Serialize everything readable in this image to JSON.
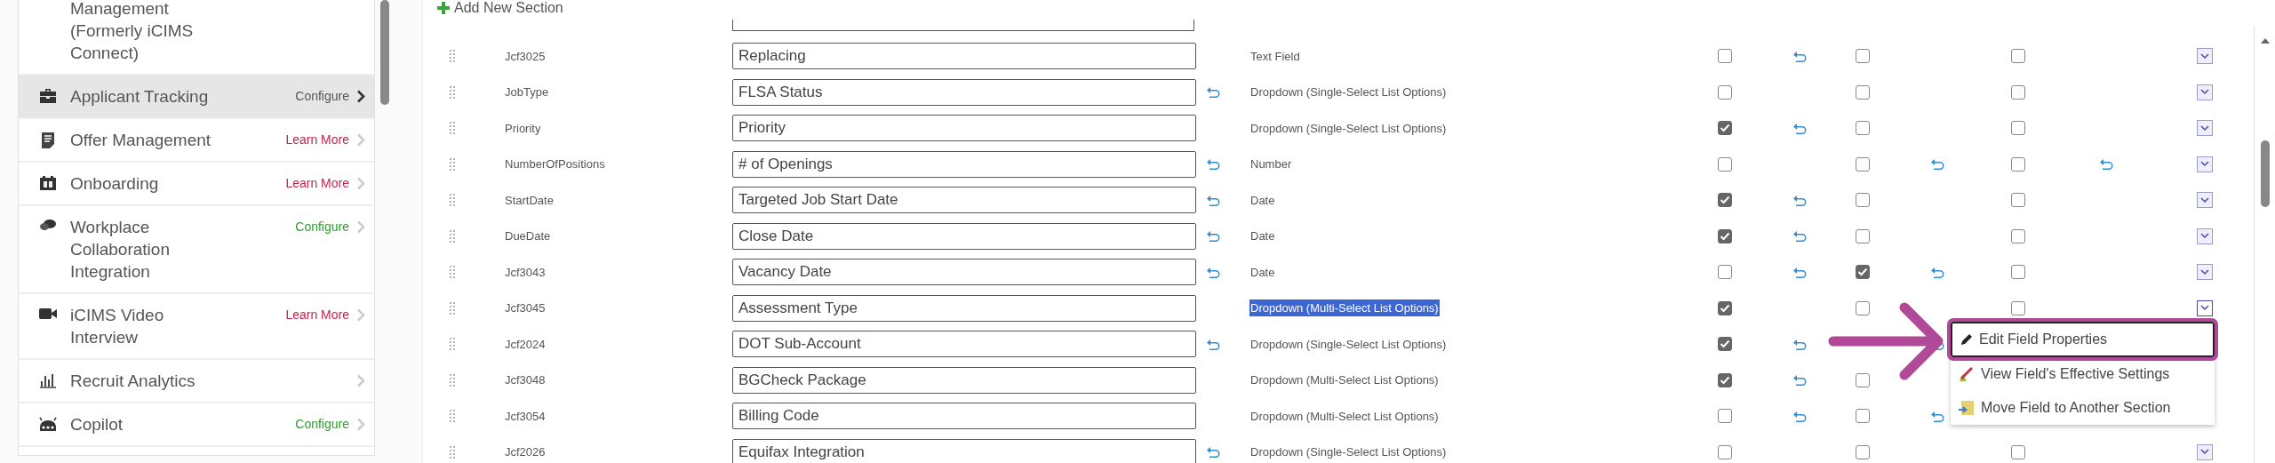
{
  "sidebar": {
    "items": [
      {
        "label": "Management\n(Formerly iCIMS\nConnect)",
        "selected": false
      },
      {
        "label": "Applicant Tracking",
        "selected": true,
        "action": {
          "label": "Configure",
          "color": "#555555"
        }
      },
      {
        "label": "Offer Management",
        "selected": false,
        "action": {
          "label": "Learn More",
          "color": "#c0264b"
        }
      },
      {
        "label": "Onboarding",
        "selected": false,
        "action": {
          "label": "Learn More",
          "color": "#c0264b"
        }
      },
      {
        "label": "Workplace\nCollaboration\nIntegration",
        "selected": false,
        "action": {
          "label": "Configure",
          "color": "#2e9e2e"
        }
      },
      {
        "label": "iCIMS Video\nInterview",
        "selected": false,
        "action": {
          "label": "Learn More",
          "color": "#c0264b"
        }
      },
      {
        "label": "Recruit Analytics",
        "selected": false,
        "chevron": true
      },
      {
        "label": "Copilot",
        "selected": false,
        "action": {
          "label": "Configure",
          "color": "#2e9e2e"
        }
      }
    ]
  },
  "toolbar": {
    "add_section": "Add New Section"
  },
  "rows": [
    {
      "code": "Jcf3025",
      "label": "Replacing",
      "label_revert": false,
      "type": "Text Field",
      "type_selected": false,
      "check_1": false,
      "revert_1": true,
      "check_2": false,
      "revert_2": false,
      "check_3": false,
      "revert_3": false,
      "menu_open": false
    },
    {
      "code": "JobType",
      "label": "FLSA Status",
      "label_revert": true,
      "type": "Dropdown (Single-Select List Options)",
      "type_selected": false,
      "check_1": false,
      "revert_1": false,
      "check_2": false,
      "revert_2": false,
      "check_3": false,
      "revert_3": false,
      "menu_open": false
    },
    {
      "code": "Priority",
      "label": "Priority",
      "label_revert": false,
      "type": "Dropdown (Single-Select List Options)",
      "type_selected": false,
      "check_1": true,
      "revert_1": true,
      "check_2": false,
      "revert_2": false,
      "check_3": false,
      "revert_3": false,
      "menu_open": false
    },
    {
      "code": "NumberOfPositions",
      "label": "# of Openings",
      "label_revert": true,
      "type": "Number",
      "type_selected": false,
      "check_1": false,
      "revert_1": false,
      "check_2": false,
      "revert_2": true,
      "check_3": false,
      "revert_3": true,
      "menu_open": false
    },
    {
      "code": "StartDate",
      "label": "Targeted Job Start Date",
      "label_revert": true,
      "type": "Date",
      "type_selected": false,
      "check_1": true,
      "revert_1": true,
      "check_2": false,
      "revert_2": false,
      "check_3": false,
      "revert_3": false,
      "menu_open": false
    },
    {
      "code": "DueDate",
      "label": "Close Date",
      "label_revert": true,
      "type": "Date",
      "type_selected": false,
      "check_1": true,
      "revert_1": true,
      "check_2": false,
      "revert_2": false,
      "check_3": false,
      "revert_3": false,
      "menu_open": false
    },
    {
      "code": "Jcf3043",
      "label": "Vacancy Date",
      "label_revert": true,
      "type": "Date",
      "type_selected": false,
      "check_1": false,
      "revert_1": true,
      "check_2": true,
      "revert_2": true,
      "check_3": false,
      "revert_3": false,
      "menu_open": false
    },
    {
      "code": "Jcf3045",
      "label": "Assessment Type",
      "label_revert": false,
      "type": "Dropdown (Multi-Select List Options)",
      "type_selected": true,
      "check_1": true,
      "revert_1": false,
      "check_2": false,
      "revert_2": false,
      "check_3": false,
      "revert_3": false,
      "menu_open": true
    },
    {
      "code": "Jcf2024",
      "label": "DOT Sub-Account",
      "label_revert": true,
      "type": "Dropdown (Single-Select List Options)",
      "type_selected": false,
      "check_1": true,
      "revert_1": true,
      "revert_2": true,
      "revert_3": false
    },
    {
      "code": "Jcf3048",
      "label": "BGCheck Package",
      "label_revert": false,
      "type": "Dropdown (Multi-Select List Options)",
      "type_selected": false,
      "check_1": true,
      "revert_1": true,
      "check_2": false,
      "revert_2": false,
      "revert_3": false
    },
    {
      "code": "Jcf3054",
      "label": "Billing Code",
      "label_revert": false,
      "type": "Dropdown (Multi-Select List Options)",
      "type_selected": false,
      "check_1": false,
      "revert_1": true,
      "check_2": false,
      "revert_2": true,
      "revert_3": false
    },
    {
      "code": "Jcf2026",
      "label": "Equifax Integration",
      "label_revert": true,
      "type": "Dropdown (Single-Select List Options)",
      "type_selected": false,
      "check_1": false,
      "revert_1": false,
      "check_2": false,
      "revert_2": false,
      "check_3": false,
      "revert_3": false,
      "menu_open": false
    }
  ],
  "context_menu": {
    "items": [
      {
        "label": "Edit Field Properties",
        "selected": true
      },
      {
        "label": "View Field's Effective Settings",
        "selected": false
      },
      {
        "label": "Move Field to Another Section",
        "selected": false
      }
    ]
  }
}
